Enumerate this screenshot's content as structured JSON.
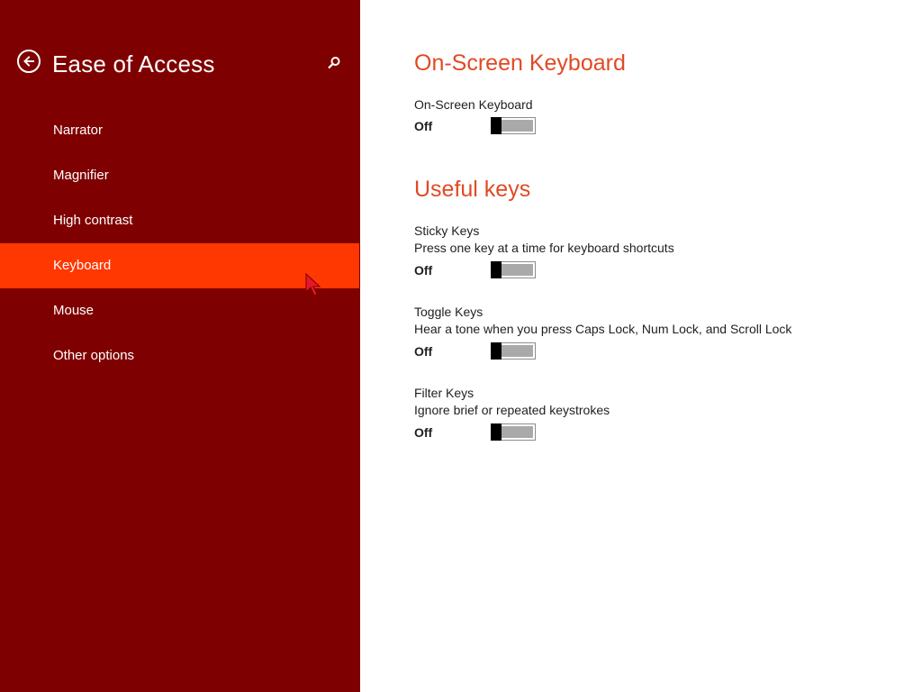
{
  "sidebar": {
    "title": "Ease of Access",
    "back_icon": "back-arrow-icon",
    "search_icon": "search-icon",
    "background": "#7f0000",
    "selected_color": "#ff3700",
    "items": [
      {
        "label": "Narrator",
        "selected": false
      },
      {
        "label": "Magnifier",
        "selected": false
      },
      {
        "label": "High contrast",
        "selected": false
      },
      {
        "label": "Keyboard",
        "selected": true
      },
      {
        "label": "Mouse",
        "selected": false
      },
      {
        "label": "Other options",
        "selected": false
      }
    ]
  },
  "main": {
    "heading_color": "#e04a24",
    "onscreen": {
      "heading": "On-Screen Keyboard",
      "label": "On-Screen Keyboard",
      "state": "Off"
    },
    "useful_keys": {
      "heading": "Useful keys",
      "sticky": {
        "label": "Sticky Keys",
        "description": "Press one key at a time for keyboard shortcuts",
        "state": "Off"
      },
      "toggle": {
        "label": "Toggle Keys",
        "description": "Hear a tone when you press Caps Lock, Num Lock, and Scroll Lock",
        "state": "Off"
      },
      "filter": {
        "label": "Filter Keys",
        "description": "Ignore brief or repeated keystrokes",
        "state": "Off"
      }
    }
  }
}
